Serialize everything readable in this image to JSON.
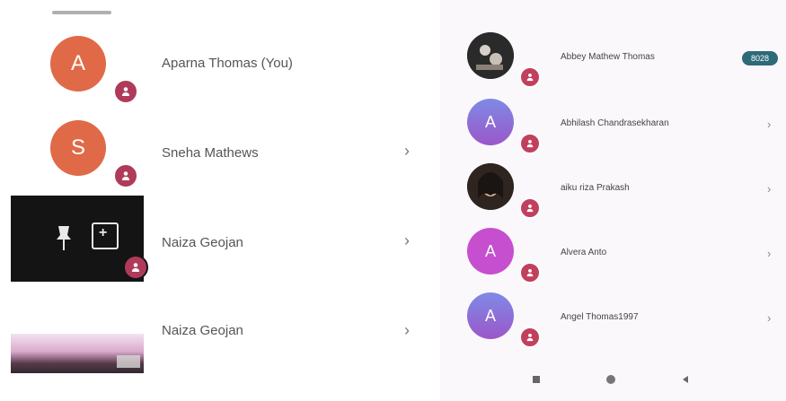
{
  "colors": {
    "accent_orange": "#e06a48",
    "accent_purple": "#8a64d6",
    "accent_pink": "#c54fcf",
    "badge_red": "#b03a5a",
    "tag_teal": "#2e6a78"
  },
  "left_list": [
    {
      "initial": "A",
      "name": "Aparna Thomas (You)",
      "chevron": ""
    },
    {
      "initial": "S",
      "name": "Sneha Mathews",
      "chevron": "›"
    },
    {
      "initial": "",
      "name": "Naiza Geojan",
      "chevron": "›"
    },
    {
      "initial": "",
      "name": "Naiza Geojan",
      "chevron": "›"
    }
  ],
  "right_list": [
    {
      "initial": "",
      "name": "Abbey Mathew Thomas",
      "tag": "8028",
      "chevron": ""
    },
    {
      "initial": "A",
      "name": "Abhilash Chandrasekharan",
      "tag": "",
      "chevron": "›"
    },
    {
      "initial": "",
      "name": "aiku riza Prakash",
      "tag": "",
      "chevron": "›"
    },
    {
      "initial": "A",
      "name": "Alvera Anto",
      "tag": "",
      "chevron": "›"
    },
    {
      "initial": "A",
      "name": "Angel Thomas1997",
      "tag": "",
      "chevron": "›"
    }
  ],
  "icons": {
    "pin": "pin-icon",
    "add_box": "add-box-icon",
    "person_badge": "person-badge-icon",
    "nav_square": "square-icon",
    "nav_circle": "home-icon",
    "nav_back": "back-icon"
  }
}
